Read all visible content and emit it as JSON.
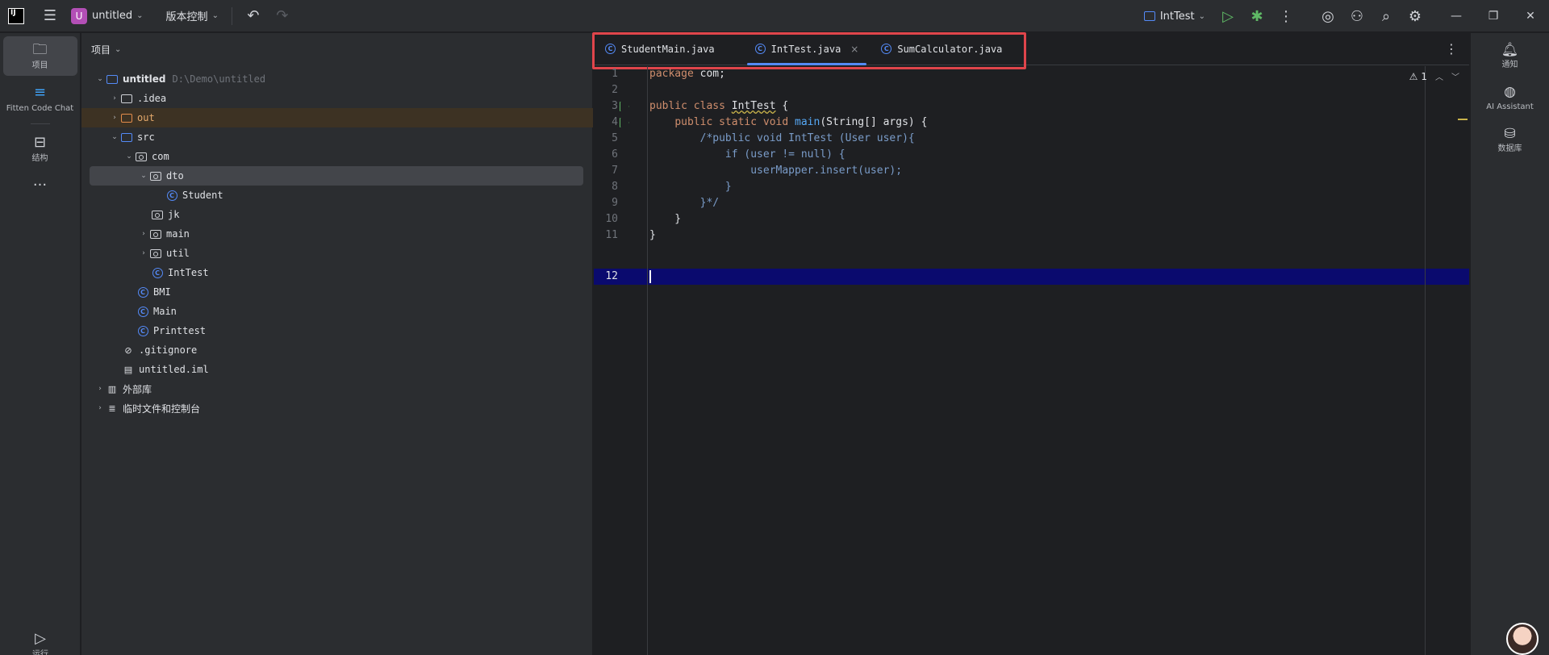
{
  "titlebar": {
    "logo": "IJ",
    "project_initial": "U",
    "project_name": "untitled",
    "vcs_label": "版本控制",
    "run_config": "IntTest"
  },
  "left_strip": {
    "items": [
      {
        "label": "项目",
        "icon": "folder-icon"
      },
      {
        "label": "Fitten Code Chat",
        "icon": "fitten-icon"
      },
      {
        "label": "结构",
        "icon": "structure-icon"
      },
      {
        "label": "",
        "icon": "more-icon"
      }
    ],
    "bottom_label": "运行"
  },
  "project_panel": {
    "header": "项目",
    "tree": [
      {
        "label": "untitled",
        "hint": "D:\\Demo\\untitled"
      },
      {
        "label": ".idea"
      },
      {
        "label": "out"
      },
      {
        "label": "src"
      },
      {
        "label": "com"
      },
      {
        "label": "dto"
      },
      {
        "label": "Student"
      },
      {
        "label": "jk"
      },
      {
        "label": "main"
      },
      {
        "label": "util"
      },
      {
        "label": "IntTest"
      },
      {
        "label": "BMI"
      },
      {
        "label": "Main"
      },
      {
        "label": "Printtest"
      },
      {
        "label": ".gitignore"
      },
      {
        "label": "untitled.iml"
      },
      {
        "label": "外部库"
      },
      {
        "label": "临时文件和控制台"
      }
    ]
  },
  "editor": {
    "tabs": [
      {
        "label": "StudentMain.java"
      },
      {
        "label": "IntTest.java",
        "close": "×"
      },
      {
        "label": "SumCalculator.java"
      }
    ],
    "warning_count": "1",
    "line_numbers": [
      "1",
      "2",
      "3",
      "4",
      "5",
      "6",
      "7",
      "8",
      "9",
      "10",
      "11",
      "12"
    ],
    "code": {
      "l1_kw": "package",
      "l1_rest": " com;",
      "l3_kw": "public class ",
      "l3_name": "IntTest",
      "l3_rest": " {",
      "l4_indent": "    ",
      "l4_kw": "public static void ",
      "l4_fn": "main",
      "l4_rest": "(String[] args) {",
      "l5": "        /*public void IntTest (User user){",
      "l6": "            if (user != null) {",
      "l7": "                userMapper.insert(user);",
      "l8": "            }",
      "l9": "        }*/",
      "l10": "    }",
      "l11": "}"
    }
  },
  "right_strip": {
    "items": [
      {
        "label": "通知",
        "icon": "bell-icon"
      },
      {
        "label": "AI Assistant",
        "icon": "ai-assistant-icon"
      },
      {
        "label": "数据库",
        "icon": "database-icon"
      }
    ]
  },
  "colors": {
    "accent": "#548af7",
    "highlight_box": "#e0454b",
    "keyword": "#cf8e6d",
    "current_line": "#0a0a6e"
  }
}
